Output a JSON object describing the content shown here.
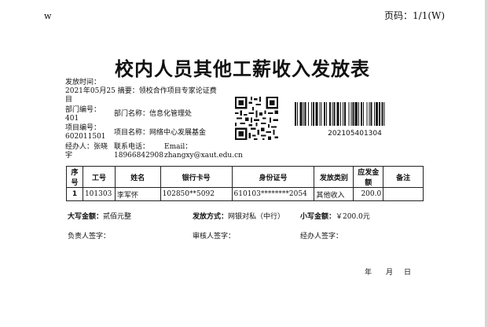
{
  "header": {
    "left_mark": "w",
    "page_label": "页码：",
    "page_value": "1/1(W)"
  },
  "title": "校内人员其他工薪收入发放表",
  "info": {
    "issue_time_label": "发放时间：",
    "issue_time_value": "2021年05月25",
    "summary_label": "摘要：",
    "summary_value": "领校合作项目专家论证费",
    "summary_wrap": "目",
    "dept_no_label": "部门编号：",
    "dept_no_value": "401",
    "dept_name_label": "部门名称：",
    "dept_name_value": "信息化管理处",
    "project_no_label": "项目编号：",
    "project_no_value": "602011501",
    "project_name_label": "项目名称：",
    "project_name_value": "网络中心发展基金",
    "handler_label": "经办人：",
    "handler_value": "张晓",
    "handler_wrap": "宇",
    "phone_label": "联系电话：",
    "phone_value": "18966842908",
    "email_label": "Email：",
    "email_value": "zhangxy@xaut.edu.cn"
  },
  "barcode_number": "202105401304",
  "table": {
    "headers": [
      "序号",
      "工号",
      "姓名",
      "银行卡号",
      "身份证号",
      "发放类别",
      "应发金额",
      "备注"
    ],
    "rows": [
      [
        "1",
        "101303",
        "李军怀",
        "102850**5092",
        "610103********2054",
        "其他收入",
        "200.0",
        ""
      ]
    ]
  },
  "summary": {
    "upper_amount_label": "大写金额：",
    "upper_amount_value": "贰佰元整",
    "pay_method_label": "发放方式：",
    "pay_method_value": "网银对私（中行）",
    "lower_amount_label": "小写金额：",
    "lower_amount_value": "￥200.0元"
  },
  "signatures": {
    "person_in_charge": "负责人签字：",
    "reviewer": "审核人签字：",
    "handler": "经办人签字："
  },
  "date_line": {
    "year": "年",
    "month": "月",
    "day": "日"
  }
}
